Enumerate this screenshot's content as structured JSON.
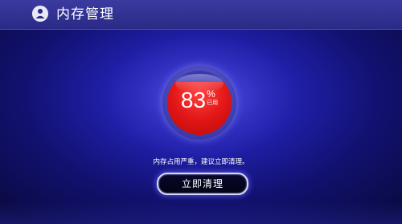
{
  "header": {
    "title": "内存管理",
    "icon": "user-broom-icon"
  },
  "gauge": {
    "value": "83",
    "unit": "%",
    "label": "已用",
    "percent_used": 83,
    "fill_color": "#e01414"
  },
  "notice": "内存占用严重，建议立即清理。",
  "action": {
    "label": "立即清理"
  },
  "colors": {
    "background": "#1f1fa8",
    "header": "#2f2e8e",
    "gauge_fill": "#e01414",
    "button_border": "#d8d8ff"
  }
}
